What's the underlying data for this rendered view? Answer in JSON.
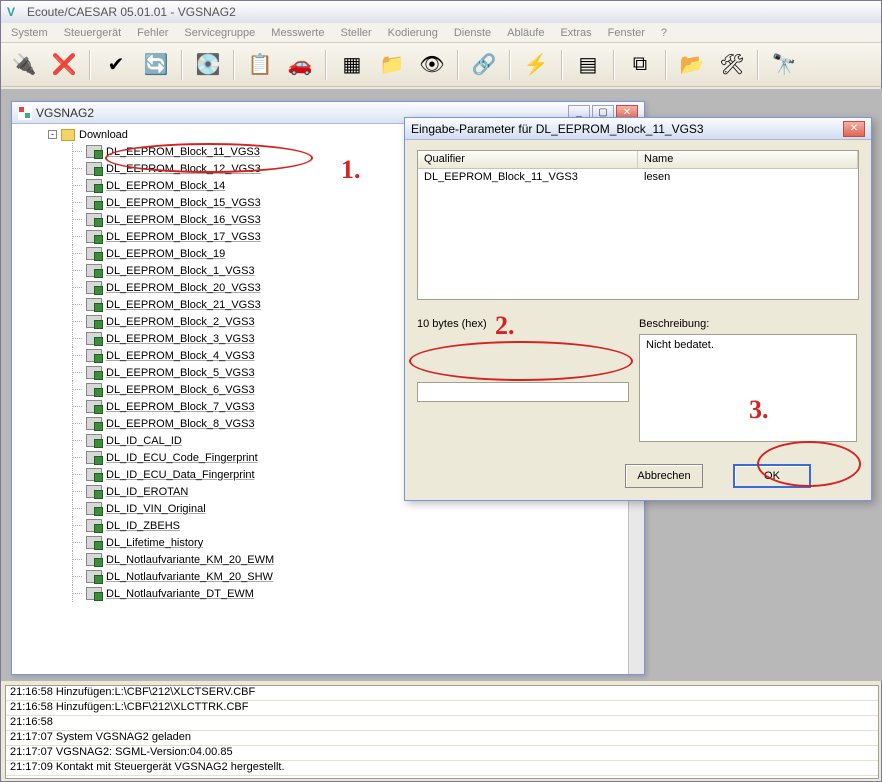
{
  "app": {
    "title": "Ecoute/CAESAR 05.01.01 - VGSNAG2",
    "mdi_title": "VGSNAG2"
  },
  "menu": {
    "items": [
      "System",
      "Steuergerät",
      "Fehler",
      "Servicegruppe",
      "Messwerte",
      "Steller",
      "Kodierung",
      "Dienste",
      "Abläufe",
      "Extras",
      "Fenster",
      "?"
    ]
  },
  "toolbar": {
    "buttons": [
      {
        "name": "connect",
        "glyph": "🔌"
      },
      {
        "name": "disconnect",
        "glyph": "❌"
      },
      {
        "name": "check",
        "glyph": "✔"
      },
      {
        "name": "refresh",
        "glyph": "🔄"
      },
      {
        "name": "ecu",
        "glyph": "💽"
      },
      {
        "name": "faults",
        "glyph": "📋"
      },
      {
        "name": "car",
        "glyph": "🚗"
      },
      {
        "name": "grid",
        "glyph": "▦"
      },
      {
        "name": "folder-cfg",
        "glyph": "📁"
      },
      {
        "name": "eye",
        "glyph": "👁"
      },
      {
        "name": "link",
        "glyph": "🔗"
      },
      {
        "name": "flash",
        "glyph": "⚡"
      },
      {
        "name": "table",
        "glyph": "▤"
      },
      {
        "name": "filter",
        "glyph": "⧉"
      },
      {
        "name": "folder-out",
        "glyph": "📂"
      },
      {
        "name": "tools",
        "glyph": "🛠"
      },
      {
        "name": "binoculars",
        "glyph": "🔭"
      }
    ]
  },
  "tree": {
    "folder": "Download",
    "items": [
      "DL_EEPROM_Block_11_VGS3",
      "DL_EEPROM_Block_12_VGS3",
      "DL_EEPROM_Block_14",
      "DL_EEPROM_Block_15_VGS3",
      "DL_EEPROM_Block_16_VGS3",
      "DL_EEPROM_Block_17_VGS3",
      "DL_EEPROM_Block_19",
      "DL_EEPROM_Block_1_VGS3",
      "DL_EEPROM_Block_20_VGS3",
      "DL_EEPROM_Block_21_VGS3",
      "DL_EEPROM_Block_2_VGS3",
      "DL_EEPROM_Block_3_VGS3",
      "DL_EEPROM_Block_4_VGS3",
      "DL_EEPROM_Block_5_VGS3",
      "DL_EEPROM_Block_6_VGS3",
      "DL_EEPROM_Block_7_VGS3",
      "DL_EEPROM_Block_8_VGS3",
      "DL_ID_CAL_ID",
      "DL_ID_ECU_Code_Fingerprint",
      "DL_ID_ECU_Data_Fingerprint",
      "DL_ID_EROTAN",
      "DL_ID_VIN_Original",
      "DL_ID_ZBEHS",
      "DL_Lifetime_history",
      "DL_Notlaufvariante_KM_20_EWM",
      "DL_Notlaufvariante_KM_20_SHW",
      "DL_Notlaufvariante_DT_EWM"
    ]
  },
  "dialog": {
    "title": "Eingabe-Parameter für DL_EEPROM_Block_11_VGS3",
    "col_qualifier": "Qualifier",
    "col_name": "Name",
    "row_qualifier": "DL_EEPROM_Block_11_VGS3",
    "row_name": "lesen",
    "bytes_label": "10 bytes (hex)",
    "desc_label": "Beschreibung:",
    "desc_value": "Nicht bedatet.",
    "hex_value": "",
    "cancel": "Abbrechen",
    "ok": "OK"
  },
  "annotations": {
    "n1": "1.",
    "n2": "2.",
    "n3": "3."
  },
  "log": {
    "lines": [
      "21:16:58 Hinzufügen:L:\\CBF\\212\\XLCTSERV.CBF",
      "21:16:58 Hinzufügen:L:\\CBF\\212\\XLCTTRK.CBF",
      "21:16:58",
      "21:17:07 System VGSNAG2 geladen",
      "21:17:07 VGSNAG2: SGML-Version:04.00.85",
      "21:17:09 Kontakt mit Steuergerät VGSNAG2 hergestellt."
    ]
  }
}
